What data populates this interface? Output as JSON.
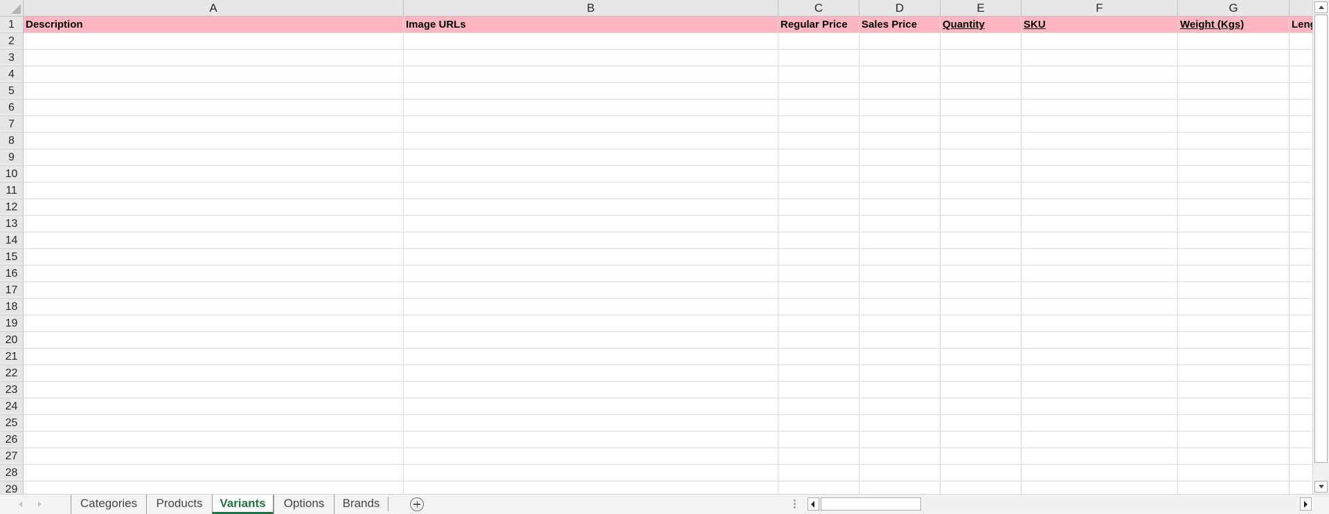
{
  "columns": [
    "A",
    "B",
    "C",
    "D",
    "E",
    "F",
    "G"
  ],
  "rows": [
    "1",
    "2",
    "3",
    "4",
    "5",
    "6",
    "7",
    "8",
    "9",
    "10",
    "11",
    "12",
    "13",
    "14",
    "15",
    "16",
    "17",
    "18",
    "19",
    "20",
    "21",
    "22",
    "23",
    "24",
    "25",
    "26",
    "27",
    "28",
    "29"
  ],
  "header_row": {
    "description": "Description",
    "image_urls": "Image URLs",
    "regular_price": "Regular Price",
    "sales_price": "Sales Price",
    "quantity": "Quantity",
    "sku": "SKU",
    "weight": "Weight (Kgs)",
    "length_partial": "Leng"
  },
  "sheet_tabs": [
    "Categories",
    "Products",
    "Variants",
    "Options",
    "Brands"
  ],
  "active_tab": "Variants",
  "colors": {
    "header_fill": "#ffb6c1",
    "active_tab_text": "#217346",
    "gridline": "#d9d9d9",
    "header_bg": "#e6e6e6"
  },
  "icons": {
    "select_all": "select-all-triangle-icon",
    "new_sheet": "plus-circle-icon",
    "scroll_up": "caret-up-icon",
    "scroll_down": "caret-down-icon",
    "scroll_left": "caret-left-icon",
    "scroll_right": "caret-right-icon"
  }
}
